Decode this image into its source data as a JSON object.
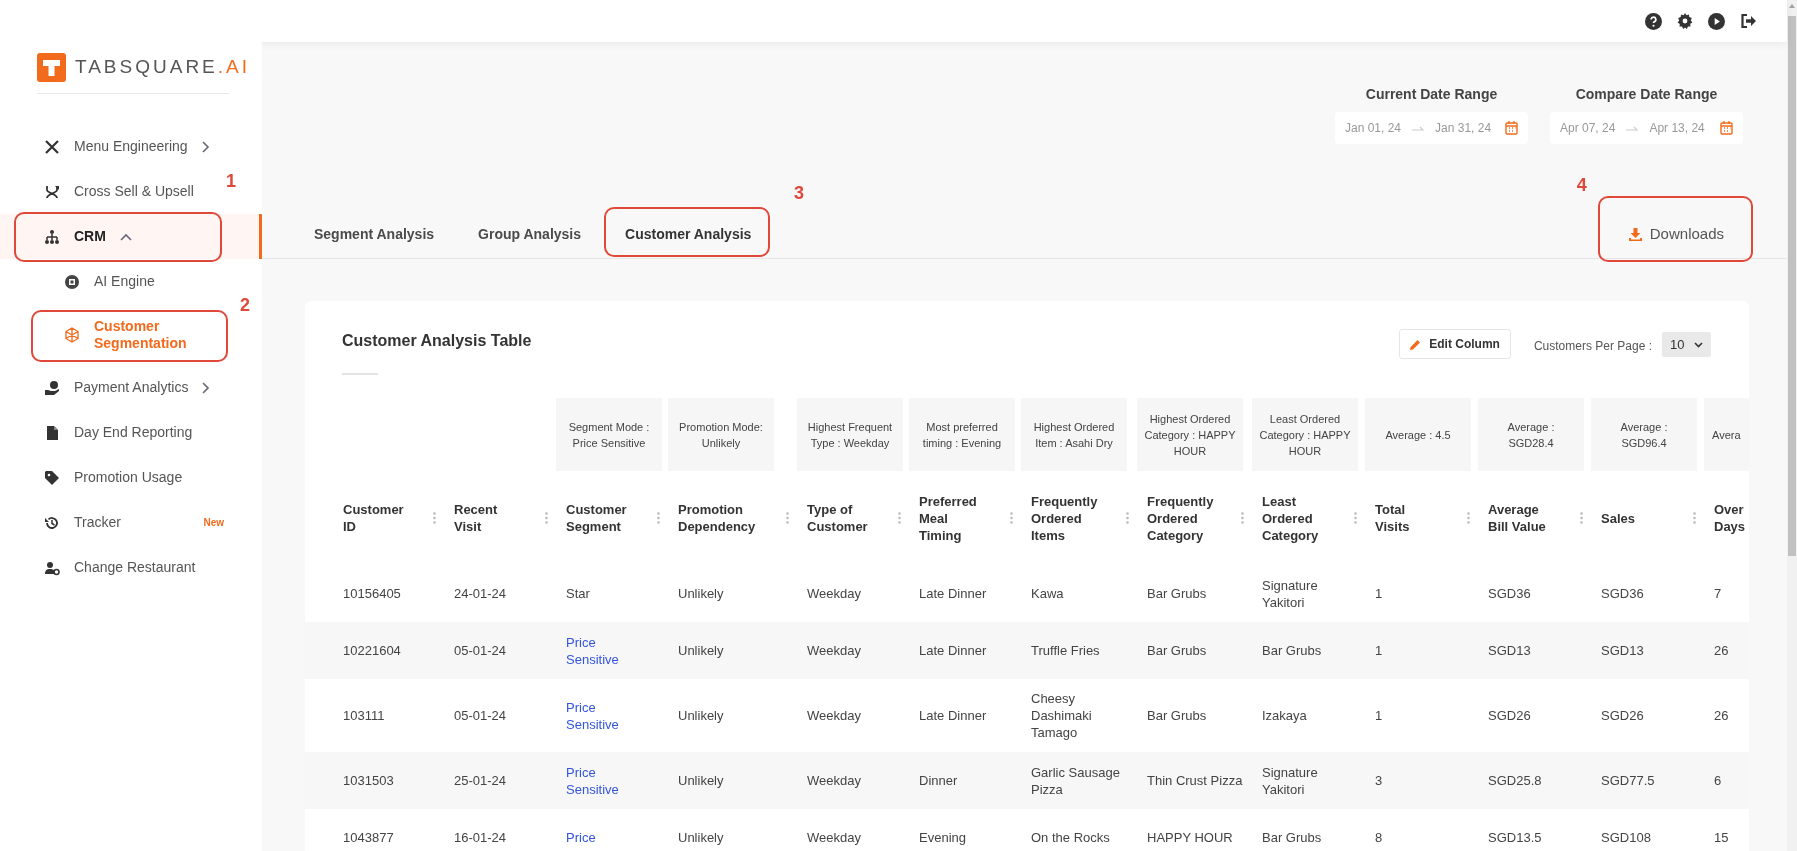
{
  "logo": {
    "name": "TABSQUARE",
    "suffix": ".AI"
  },
  "sidebar": {
    "items": [
      {
        "label": "Menu Engineering",
        "selected": false,
        "expanded": false
      },
      {
        "label": "Cross Sell & Upsell",
        "selected": false
      },
      {
        "label": "CRM",
        "selected": true,
        "expanded": true,
        "callout": "1",
        "children": [
          {
            "label": "AI Engine",
            "selected": false
          },
          {
            "label": "Customer Segmentation",
            "selected": true,
            "callout": "2"
          }
        ]
      },
      {
        "label": "Payment Analytics",
        "selected": false,
        "expanded": false
      },
      {
        "label": "Day End Reporting",
        "selected": false
      },
      {
        "label": "Promotion Usage",
        "selected": false
      },
      {
        "label": "Tracker",
        "selected": false,
        "badge": "New"
      },
      {
        "label": "Change Restaurant",
        "selected": false
      }
    ]
  },
  "date_ranges": [
    {
      "label": "Current Date Range",
      "start": "Jan 01, 24",
      "end": "Jan 31, 24"
    },
    {
      "label": "Compare Date Range",
      "start": "Apr 07, 24",
      "end": "Apr 13, 24"
    }
  ],
  "tabs": [
    {
      "label": "Segment Analysis",
      "selected": false
    },
    {
      "label": "Group Analysis",
      "selected": false
    },
    {
      "label": "Customer Analysis",
      "selected": true,
      "callout": "3"
    }
  ],
  "downloads": {
    "label": "Downloads",
    "callout": "4"
  },
  "table": {
    "title": "Customer Analysis Table",
    "edit_button": "Edit Column",
    "per_page_label": "Customers Per Page :",
    "per_page": "10",
    "summaries": [
      "Segment Mode : Price Sensitive",
      "Promotion Mode: Unlikely",
      "Highest Frequent Type : Weekday",
      "Most preferred timing : Evening",
      "Highest Ordered Item : Asahi Dry",
      "Highest Ordered Category : HAPPY HOUR",
      "Least Ordered Category : HAPPY HOUR",
      "Average : 4.5",
      "Average : SGD28.4",
      "Average : SGD96.4",
      "Avera"
    ],
    "columns": [
      "Customer ID",
      "Recent Visit",
      "Customer Segment",
      "Promotion Dependency",
      "Type of Customer",
      "Preferred Meal Timing",
      "Frequently Ordered Items",
      "Frequently Ordered Category",
      "Least Ordered Category",
      "Total Visits",
      "Average Bill Value",
      "Sales",
      "Over Days"
    ],
    "rows": [
      {
        "cells": [
          "10156405",
          "24-01-24",
          "Star",
          "Unlikely",
          "Weekday",
          "Late Dinner",
          "Kawa",
          "Bar Grubs",
          "Signature Yakitori",
          "1",
          "SGD36",
          "SGD36",
          "7"
        ],
        "segment_link": false
      },
      {
        "cells": [
          "10221604",
          "05-01-24",
          "Price Sensitive",
          "Unlikely",
          "Weekday",
          "Late Dinner",
          "Truffle Fries",
          "Bar Grubs",
          "Bar Grubs",
          "1",
          "SGD13",
          "SGD13",
          "26"
        ],
        "segment_link": true
      },
      {
        "cells": [
          "103111",
          "05-01-24",
          "Price Sensitive",
          "Unlikely",
          "Weekday",
          "Late Dinner",
          "Cheesy Dashimaki Tamago",
          "Bar Grubs",
          "Izakaya",
          "1",
          "SGD26",
          "SGD26",
          "26"
        ],
        "segment_link": true
      },
      {
        "cells": [
          "1031503",
          "25-01-24",
          "Price Sensitive",
          "Unlikely",
          "Weekday",
          "Dinner",
          "Garlic Sausage Pizza",
          "Thin Crust Pizza",
          "Signature Yakitori",
          "3",
          "SGD25.8",
          "SGD77.5",
          "6"
        ],
        "segment_link": true
      },
      {
        "cells": [
          "1043877",
          "16-01-24",
          "Price",
          "Unlikely",
          "Weekday",
          "Evening",
          "On the Rocks",
          "HAPPY HOUR",
          "Bar Grubs",
          "8",
          "SGD13.5",
          "SGD108",
          "15"
        ],
        "segment_link": true
      }
    ]
  }
}
